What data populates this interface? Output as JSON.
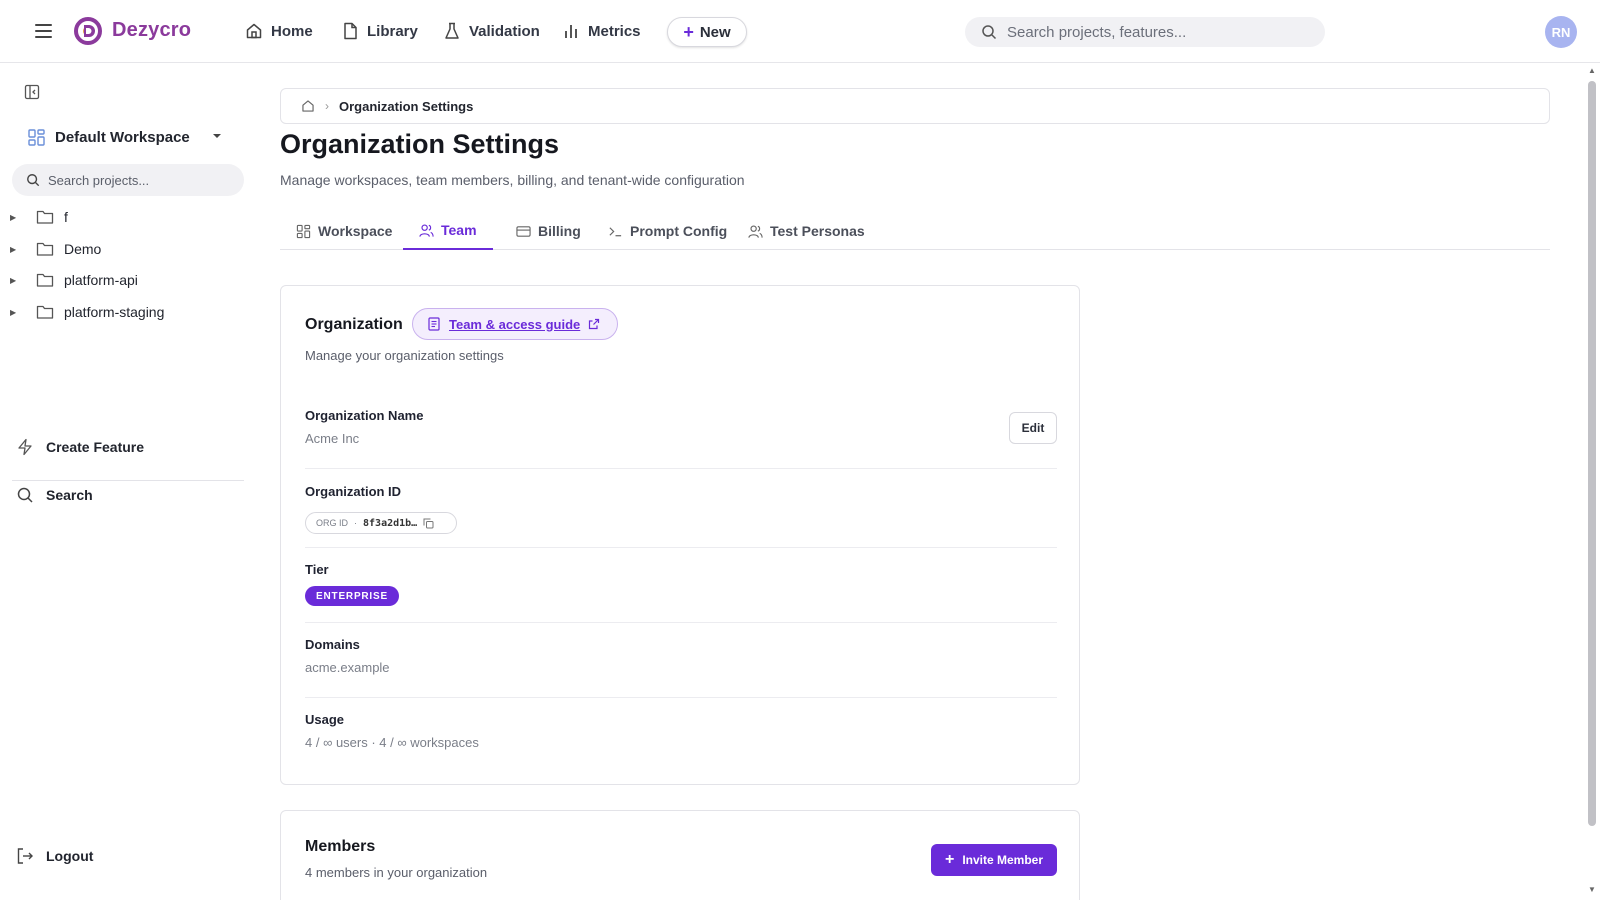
{
  "app": {
    "brand": "Dezycro",
    "nav": [
      {
        "label": "Home",
        "icon": "home-icon"
      },
      {
        "label": "Library",
        "icon": "document-icon"
      },
      {
        "label": "Validation",
        "icon": "flask-icon"
      },
      {
        "label": "Metrics",
        "icon": "bar-chart-icon"
      }
    ],
    "new_label": "New",
    "search_placeholder": "Search projects, features...",
    "avatar_initials": "RN"
  },
  "sidebar": {
    "workspace": "Default Workspace",
    "search_placeholder": "Search projects...",
    "tree": [
      {
        "label": "f"
      },
      {
        "label": "Demo"
      },
      {
        "label": "platform-api"
      },
      {
        "label": "platform-staging"
      }
    ],
    "create_feature": "Create Feature",
    "search": "Search",
    "logout": "Logout"
  },
  "breadcrumb": {
    "current": "Organization Settings"
  },
  "page": {
    "title": "Organization Settings",
    "subtitle": "Manage workspaces, team members, billing, and tenant-wide configuration"
  },
  "tabs": [
    {
      "label": "Workspace",
      "icon": "grid-icon"
    },
    {
      "label": "Team",
      "icon": "users-icon",
      "active": true
    },
    {
      "label": "Billing",
      "icon": "credit-card-icon"
    },
    {
      "label": "Prompt Config",
      "icon": "terminal-icon"
    },
    {
      "label": "Test Personas",
      "icon": "personas-icon"
    }
  ],
  "organization": {
    "title": "Organization",
    "guide_label": "Team & access guide",
    "subtitle": "Manage your organization settings",
    "name_label": "Organization Name",
    "name_value": "Acme Inc",
    "edit_label": "Edit",
    "id_label": "Organization ID",
    "id_chip_prefix": "ORG ID",
    "id_chip_sep": "·",
    "id_value": "8f3a2d1b…",
    "tier_label": "Tier",
    "tier_value": "ENTERPRISE",
    "domains_label": "Domains",
    "domains_value": "acme.example",
    "usage_label": "Usage",
    "usage_value": "4 / ∞ users · 4 / ∞ workspaces"
  },
  "members": {
    "title": "Members",
    "subtitle": "4 members in your organization",
    "invite_label": "Invite Member"
  },
  "colors": {
    "accent": "#6a2bd9",
    "brand": "#8b3a9c",
    "avatar": "#a8b4f0"
  }
}
